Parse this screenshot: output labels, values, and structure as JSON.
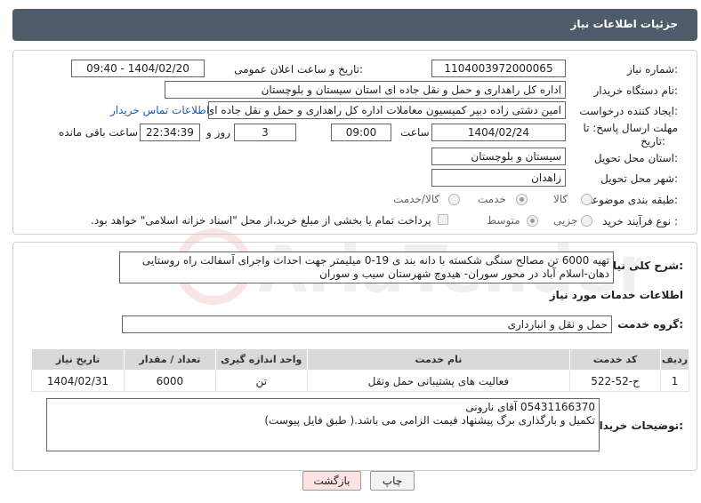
{
  "header": {
    "title": "جزئیات اطلاعات نیاز"
  },
  "form": {
    "need_number_label": "شماره نیاز:",
    "need_number": "1104003972000065",
    "announce_label": "تاریخ و ساعت اعلان عمومی:",
    "announce_value": "1404/02/20 - 09:40",
    "buyer_label": "نام دستگاه خریدار:",
    "buyer_value": "اداره کل راهداری و حمل و نقل جاده ای استان سیستان و بلوچستان",
    "creator_label": "ایجاد کننده درخواست:",
    "creator_value": "امین دشتی زاده دبیر کمیسیون معاملات اداره کل راهداری و حمل و نقل جاده ای",
    "contact_link": "اطلاعات تماس خریدار",
    "deadline_label_1": "مهلت ارسال پاسخ: تا",
    "deadline_label_2": "تاریخ:",
    "deadline_date": "1404/02/24",
    "time_label": "ساعت",
    "deadline_time": "09:00",
    "days_value": "3",
    "days_label": "روز و",
    "remaining_time": "22:34:39",
    "remaining_label": "ساعت باقی مانده",
    "province_label": "استان محل تحویل:",
    "province_value": "سیستان و بلوچستان",
    "city_label": "شهر محل تحویل:",
    "city_value": "زاهدان",
    "category_label": "طبقه بندی موضوعی:",
    "category_options": [
      "کالا",
      "خدمت",
      "کالا/خدمت"
    ],
    "category_selected": "خدمت",
    "process_label": "نوع فرآیند خرید :",
    "process_options": [
      "جزیی",
      "متوسط"
    ],
    "process_selected": "متوسط",
    "payment_note": "پرداخت تمام یا بخشی از مبلغ خرید،از محل \"اسناد خزانه اسلامی\" خواهد بود."
  },
  "description": {
    "label": "شرح کلی نیاز:",
    "text": "تهیه 6000 تن مصالح سنگی شکسته با دانه بند ی 19-0 میلیمتر جهت احداث واجرای آسفالت راه روستایی دهان-اسلام آباد در محور سوران- هیدوچ شهرستان سیب و سوران"
  },
  "services": {
    "section_title": "اطلاعات خدمات مورد نیاز",
    "group_label": "گروه خدمت:",
    "group_value": "حمل و نقل و انبارداری",
    "columns": [
      "ردیف",
      "کد خدمت",
      "نام خدمت",
      "واحد اندازه گیری",
      "تعداد / مقدار",
      "تاریخ نیاز"
    ],
    "rows": [
      [
        "1",
        "ح-52-522",
        "فعالیت های پشتیبانی حمل ونقل",
        "تن",
        "6000",
        "1404/02/31"
      ]
    ]
  },
  "buyer_notes": {
    "label": "توضیحات خریدار:",
    "line1": "05431166370 آقای نارونی",
    "line2": "تکمیل و بارگذاری برگ پیشنهاد قیمت الزامی می باشد.( طبق فایل پیوست)"
  },
  "buttons": {
    "print": "چاپ",
    "back": "بازگشت"
  },
  "watermark": {
    "text": "AriaTender.neT"
  }
}
